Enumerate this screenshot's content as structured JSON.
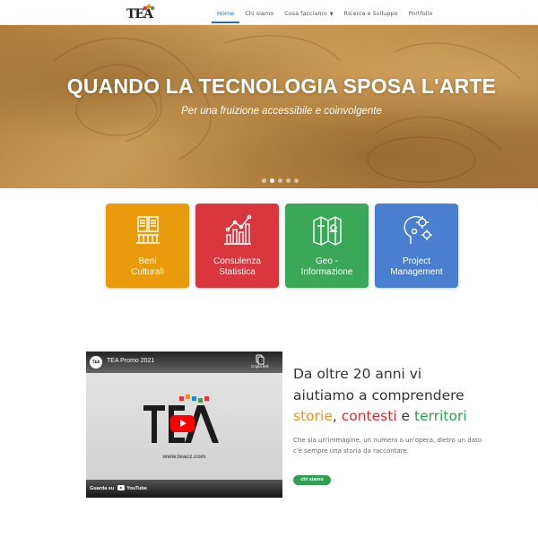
{
  "brand": {
    "logo_text": "TEA",
    "logo_colors": [
      "#e53935",
      "#fb8c00",
      "#43a047",
      "#1e88e5"
    ]
  },
  "nav": {
    "items": [
      {
        "label": "Home",
        "active": true
      },
      {
        "label": "Chi siamo"
      },
      {
        "label": "Cosa facciamo",
        "dropdown": true
      },
      {
        "label": "Ricerca e Sviluppo"
      },
      {
        "label": "Portfolio"
      }
    ],
    "accent": "#2b6cb0"
  },
  "hero": {
    "title": "QUANDO LA TECNOLOGIA SPOSA L'ARTE",
    "subtitle": "Per una fruizione accessibile e coinvolgente",
    "slides": 5,
    "active_slide": 2
  },
  "services": [
    {
      "label_1": "Beni",
      "label_2": "Culturali",
      "color": "#e99b0b",
      "icon": "temple-book-icon"
    },
    {
      "label_1": "Consulenza",
      "label_2": "Statistica",
      "color": "#d9363e",
      "icon": "chart-icon"
    },
    {
      "label_1": "Geo -",
      "label_2": "Informazione",
      "color": "#3aa857",
      "icon": "map-icon"
    },
    {
      "label_1": "Project",
      "label_2": "Management",
      "color": "#4a7fd0",
      "icon": "head-gears-icon"
    }
  ],
  "video": {
    "channel_badge": "TEA",
    "title": "TEA Promo 2021",
    "copy_label": "Copia link",
    "url_text": "www.teacz.com",
    "watch_label": "Guarda su",
    "youtube_label": "YouTube"
  },
  "about": {
    "heading_line1": "Da oltre 20 anni vi",
    "heading_line2": "aiutiamo a comprendere",
    "kw_storie": "storie",
    "kw_sep1": ", ",
    "kw_contesti": "contesti",
    "kw_sep2": " e ",
    "kw_territori": "territori",
    "kw_colors": {
      "storie": "#f0901e",
      "contesti": "#e0282f",
      "territori": "#2e9e4f"
    },
    "paragraph": "Che sia un'immagine, un numero o un'opera, dietro un dato c'è sempre una storia da raccontare.",
    "button": "chi siamo"
  }
}
